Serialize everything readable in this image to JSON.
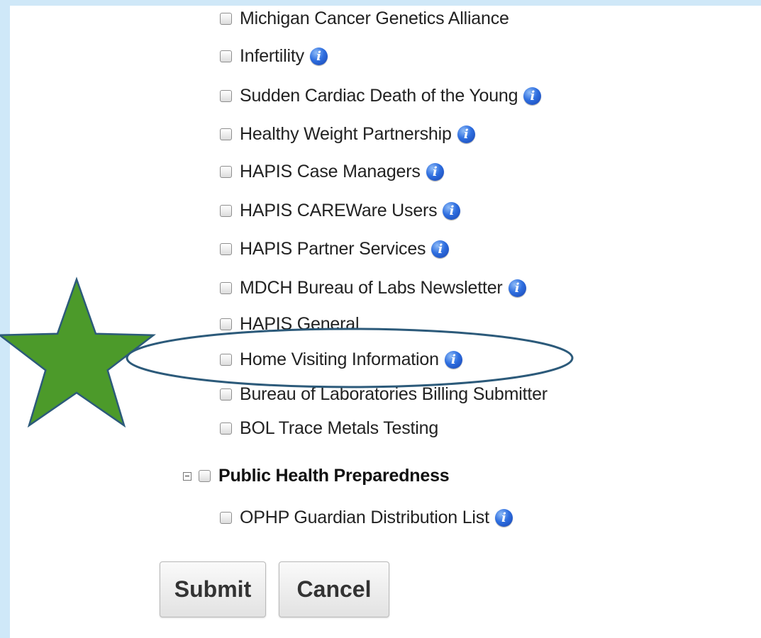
{
  "options": [
    {
      "label": "Michigan Cancer Genetics Alliance",
      "info": false
    },
    {
      "label": "Infertility",
      "info": true
    },
    {
      "label": "Sudden Cardiac Death of the Young",
      "info": true
    },
    {
      "label": "Healthy Weight Partnership",
      "info": true
    },
    {
      "label": "HAPIS Case Managers",
      "info": true
    },
    {
      "label": "HAPIS CAREWare Users",
      "info": true
    },
    {
      "label": "HAPIS Partner Services",
      "info": true
    },
    {
      "label": "MDCH Bureau of Labs Newsletter",
      "info": true
    },
    {
      "label": "HAPIS General",
      "info": false
    },
    {
      "label": "Home Visiting Information",
      "info": true
    },
    {
      "label": "Bureau of Laboratories Billing Submitter",
      "info": false
    },
    {
      "label": "BOL Trace Metals Testing",
      "info": false
    }
  ],
  "group": {
    "label": "Public Health Preparedness",
    "options": [
      {
        "label": "OPHP Guardian Distribution List",
        "info": true
      }
    ]
  },
  "info_glyph": "i",
  "buttons": {
    "submit": "Submit",
    "cancel": "Cancel"
  },
  "annotations": {
    "star_color": "#4c9a2a",
    "star_stroke": "#2c5a7a",
    "ellipse_stroke": "#2c5a7a",
    "highlighted_option": "Home Visiting Information"
  },
  "colors": {
    "page_border": "#cfe8f8",
    "info_icon": "#2f6fe0"
  }
}
